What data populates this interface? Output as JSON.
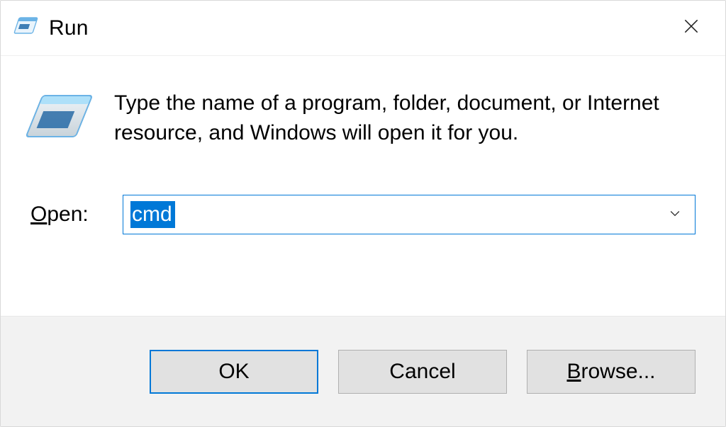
{
  "title": "Run",
  "description": "Type the name of a program, folder, document, or Internet resource, and Windows will open it for you.",
  "open_label": "Open:",
  "open_accel_index": 0,
  "combo_value": "cmd",
  "buttons": {
    "ok": "OK",
    "cancel": "Cancel",
    "browse": "Browse...",
    "browse_accel_index": 0
  }
}
